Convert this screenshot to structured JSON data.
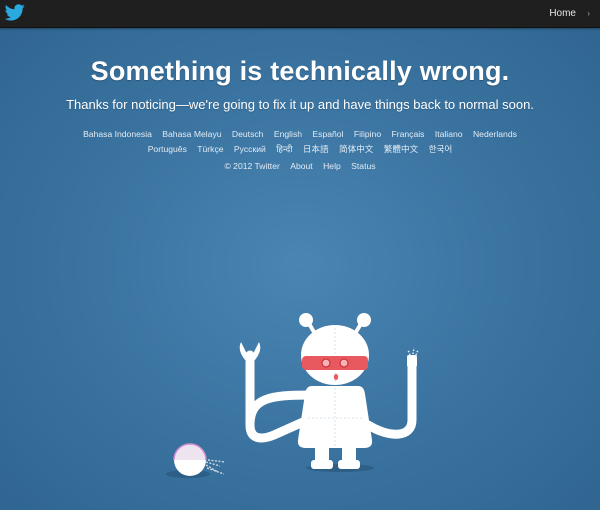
{
  "topbar": {
    "logo_icon": "twitter-bird-icon",
    "home_label": "Home",
    "caret": "›"
  },
  "main": {
    "title": "Something is technically wrong.",
    "subtitle": "Thanks for noticing—we're going to fix it up and have things back to normal soon."
  },
  "languages": {
    "row1": [
      "Bahasa Indonesia",
      "Bahasa Melayu",
      "Deutsch",
      "English",
      "Español",
      "Filipino",
      "Français",
      "Italiano",
      "Nederlands"
    ],
    "row2": [
      "Português",
      "Türkçe",
      "Русский",
      "हिन्दी",
      "日本語",
      "简体中文",
      "繁體中文",
      "한국어"
    ]
  },
  "footer": {
    "copyright": "© 2012 Twitter",
    "links": [
      "About",
      "Help",
      "Status"
    ]
  },
  "illustration": {
    "name": "broken robot illustration"
  },
  "colors": {
    "topbar": "#1f1f1f",
    "background": "#3c75a2",
    "twitter_blue": "#2aa9e0",
    "robot_visor": "#e8595f"
  }
}
